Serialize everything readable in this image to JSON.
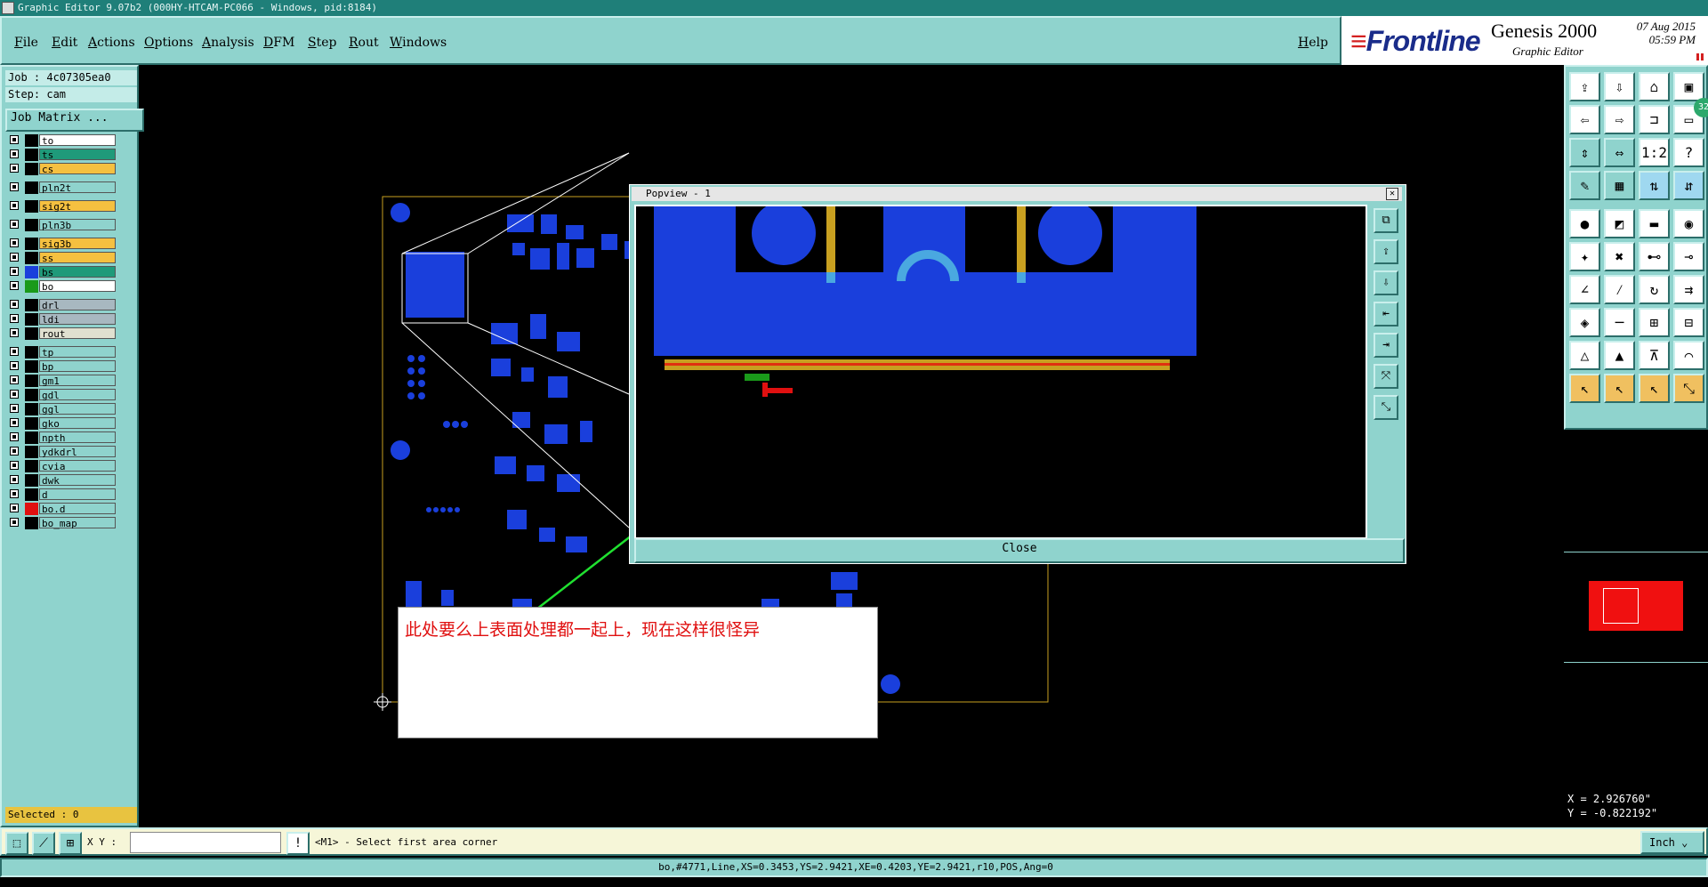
{
  "window": {
    "title": "Graphic Editor 9.07b2 (000HY-HTCAM-PC066 - Windows, pid:8184)"
  },
  "menu": {
    "items": [
      "File",
      "Edit",
      "Actions",
      "Options",
      "Analysis",
      "DFM",
      "Step",
      "Rout",
      "Windows"
    ],
    "help": "Help"
  },
  "logo": {
    "brand": "Frontline",
    "product": "Genesis 2000",
    "subtitle": "Graphic Editor",
    "date": "07 Aug 2015",
    "time": "05:59 PM"
  },
  "job": {
    "job_line": "Job : 4c07305ea0",
    "step_line": "Step: cam",
    "matrix_button": "Job Matrix ..."
  },
  "layers": [
    {
      "name": "to",
      "color": "#ffffff",
      "swatch": "#000000"
    },
    {
      "name": "ts",
      "color": "#1f9a7a",
      "swatch": "#000000"
    },
    {
      "name": "cs",
      "color": "#f5c040",
      "swatch": "#000000"
    },
    {
      "name": "pln2t",
      "color": "#8fd3cd",
      "swatch": "#000000"
    },
    {
      "name": "sig2t",
      "color": "#f5c040",
      "swatch": "#000000"
    },
    {
      "name": "pln3b",
      "color": "#8fd3cd",
      "swatch": "#000000"
    },
    {
      "name": "sig3b",
      "color": "#f5c040",
      "swatch": "#000000"
    },
    {
      "name": "ss",
      "color": "#f5c040",
      "swatch": "#000000"
    },
    {
      "name": "bs",
      "color": "#1f9a7a",
      "swatch": "#1a3fdc"
    },
    {
      "name": "bo",
      "color": "#ffffff",
      "swatch": "#1a9a1a"
    },
    {
      "name": "drl",
      "color": "#a8b8c0",
      "swatch": "#000000"
    },
    {
      "name": "ldi",
      "color": "#a8b8c0",
      "swatch": "#000000"
    },
    {
      "name": "rout",
      "color": "#e0e0d0",
      "swatch": "#000000"
    },
    {
      "name": "tp",
      "color": "#8fd3cd",
      "swatch": "#000000"
    },
    {
      "name": "bp",
      "color": "#8fd3cd",
      "swatch": "#000000"
    },
    {
      "name": "gm1",
      "color": "#8fd3cd",
      "swatch": "#000000"
    },
    {
      "name": "gdl",
      "color": "#8fd3cd",
      "swatch": "#000000"
    },
    {
      "name": "ggl",
      "color": "#8fd3cd",
      "swatch": "#000000"
    },
    {
      "name": "gko",
      "color": "#8fd3cd",
      "swatch": "#000000"
    },
    {
      "name": "npth",
      "color": "#8fd3cd",
      "swatch": "#000000"
    },
    {
      "name": "ydkdrl",
      "color": "#8fd3cd",
      "swatch": "#000000"
    },
    {
      "name": "cvia",
      "color": "#8fd3cd",
      "swatch": "#000000"
    },
    {
      "name": "dwk",
      "color": "#8fd3cd",
      "swatch": "#000000"
    },
    {
      "name": "d",
      "color": "#8fd3cd",
      "swatch": "#000000"
    },
    {
      "name": "bo.d",
      "color": "#8fd3cd",
      "swatch": "#e01010"
    },
    {
      "name": "bo_map",
      "color": "#8fd3cd",
      "swatch": "#000000"
    }
  ],
  "selected": "Selected : 0",
  "popview": {
    "title": "Popview - 1",
    "close_label": "Close"
  },
  "annotation": {
    "text": "此处要么上表面处理都一起上，现在这样很怪异"
  },
  "coords": {
    "x": "X = 2.926760\"",
    "y": "Y = -0.822192\""
  },
  "command": {
    "xy_label": "X Y :",
    "xy_value": "",
    "prompt": "<M1> - Select first area corner",
    "unit": "Inch"
  },
  "status": {
    "text": "bo,#4771,Line,XS=0.3453,YS=2.9421,XE=0.4203,YE=2.9421,r10,POS,Ang=0"
  },
  "badge": "32"
}
